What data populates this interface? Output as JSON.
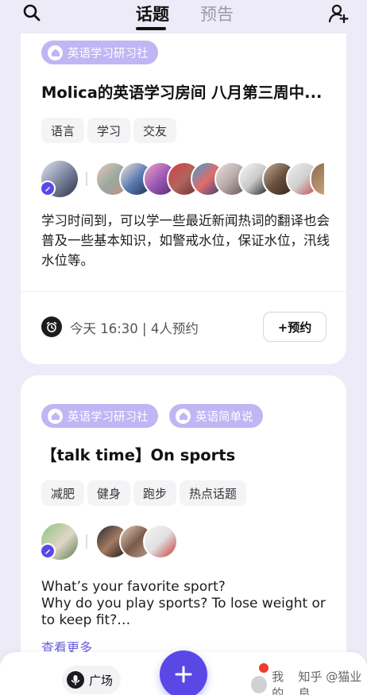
{
  "header": {
    "tabs": [
      {
        "label": "话题",
        "active": true
      },
      {
        "label": "预告",
        "active": false
      }
    ]
  },
  "rooms": [
    {
      "clubs": [
        "英语学习研习社"
      ],
      "title": "Molica的英语学习房间 八月第三周中...",
      "tags": [
        "语言",
        "学习",
        "交友"
      ],
      "description": "学习时间到，可以学一些最近新闻热词的翻译也会普及一些基本知识，如警戒水位，保证水位，汛线水位等。",
      "schedule": "今天 16:30 | 4人预约",
      "reserve_label": "+预约"
    },
    {
      "clubs": [
        "英语学习研习社",
        "英语简单说"
      ],
      "title": "【talk time】On sports",
      "tags": [
        "减肥",
        "健身",
        "跑步",
        "热点话题"
      ],
      "description": "What’s your favorite sport?\nWhy do you play sports? To lose weight or to keep fit?…",
      "more_label": "查看更多"
    }
  ],
  "bottom_nav": {
    "plaza_label": "广场",
    "mine_label": "我的",
    "watermark": "知乎 @猫业良"
  },
  "colors": {
    "accent": "#5a48e6",
    "badge": "#bfb6f3",
    "background": "#ecebf7",
    "notification": "#f03a2e"
  }
}
